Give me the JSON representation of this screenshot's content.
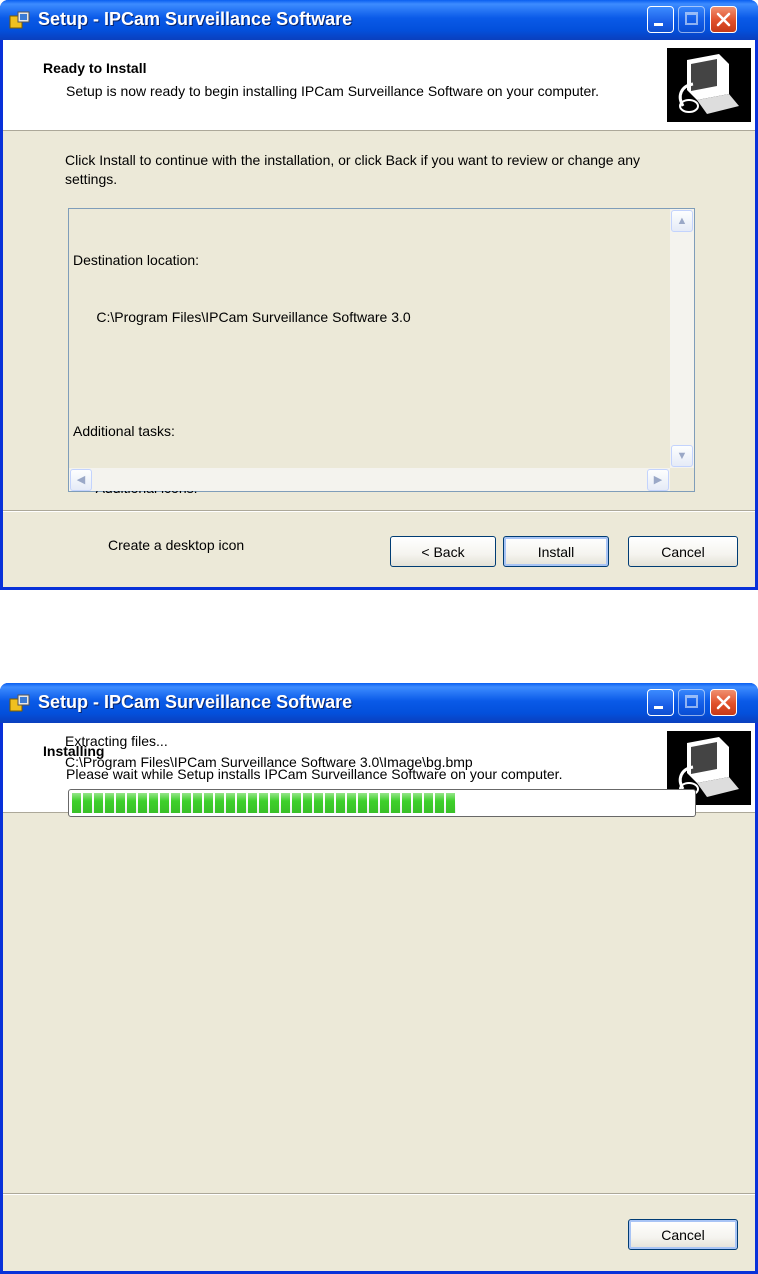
{
  "window_title": "Setup - IPCam Surveillance Software",
  "ready": {
    "heading": "Ready to Install",
    "subheading": "Setup is now ready to begin installing IPCam Surveillance Software on your computer.",
    "instructions": "Click Install to continue with the installation, or click Back if you want to review or change any settings.",
    "memo": [
      "Destination location:",
      "      C:\\Program Files\\IPCam Surveillance Software 3.0",
      "",
      "Additional tasks:",
      "      Additional icons:",
      "         Create a desktop icon"
    ],
    "back_label": "< Back",
    "install_label": "Install",
    "cancel_label": "Cancel"
  },
  "installing": {
    "heading": "Installing",
    "subheading": "Please wait while Setup installs IPCam Surveillance Software on your computer.",
    "status": "Extracting files...",
    "current_file": "C:\\Program Files\\IPCam Surveillance Software 3.0\\Image\\bg.bmp",
    "progress": 0.62,
    "cancel_label": "Cancel"
  },
  "colors": {
    "titlebar": "#0a5ae8",
    "progress": "#3ed02a",
    "face": "#ece9d8"
  },
  "icons": [
    "setup-app-icon",
    "minimize-icon",
    "maximize-icon",
    "close-icon",
    "computer-install-icon",
    "scroll-up-icon",
    "scroll-down-icon",
    "scroll-left-icon",
    "scroll-right-icon"
  ]
}
